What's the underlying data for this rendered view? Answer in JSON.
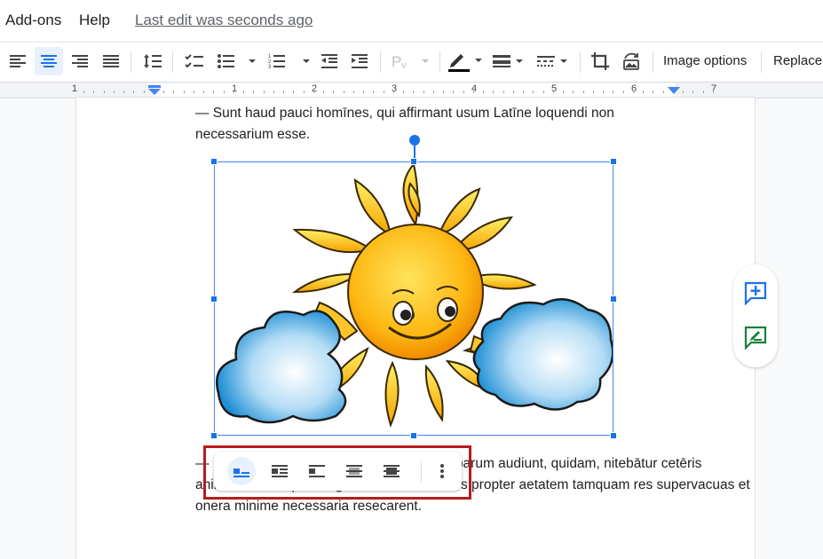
{
  "menubar": {
    "items": [
      "Add-ons",
      "Help"
    ],
    "last_edit": "Last edit was seconds ago"
  },
  "toolbar": {
    "image_options": "Image options",
    "replace": "Replace"
  },
  "ruler": {
    "numbers": [
      "1",
      "1",
      "2",
      "3",
      "4",
      "5",
      "6",
      "7"
    ]
  },
  "document": {
    "para1_line1": "— Sunt haud pauci homīnes, qui affirmant usum Latīne loquendi non",
    "para1_line2": "necessarium esse.",
    "para2_line1": "— Istius modi homĭnes, ut ego putavi, nec parum audiunt, quidam, nitebātur cetēris",
    "para2_line2": "animadvertere quod linguam Latinam omnes propter aetatem tamquam res supervacuas et",
    "para2_line3": "onera minime necessaria resecarent."
  },
  "floating_toolbar": {
    "buttons": [
      "inline-icon",
      "wrap-text-icon",
      "break-text-icon",
      "behind-text-icon",
      "in-front-of-text-icon",
      "more-options-icon"
    ]
  },
  "side_panel": {
    "buttons": [
      "add-comment-icon",
      "suggest-edits-icon"
    ]
  },
  "colors": {
    "accent": "#1a73e8",
    "highlight": "#b71c1c",
    "suggest": "#188038"
  }
}
